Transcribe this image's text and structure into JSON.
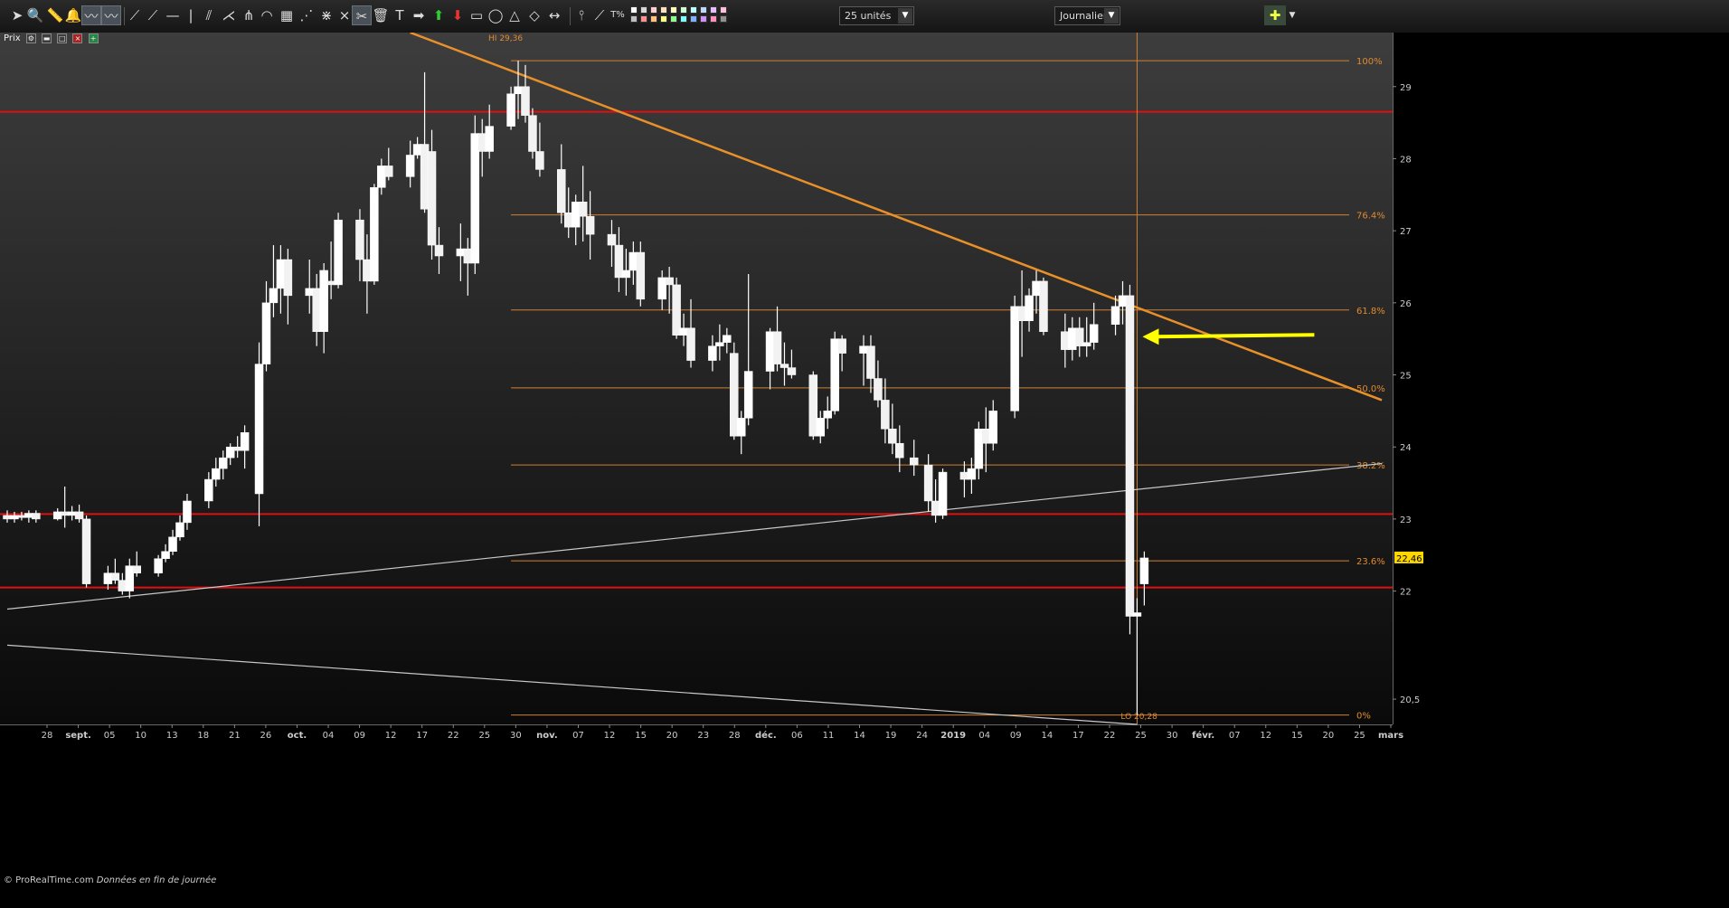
{
  "toolbar": {
    "units_value": "25 unités",
    "period_value": "Journalier",
    "swatch_colors": [
      "#ffffff",
      "#d8d8d8",
      "#ffd0d0",
      "#ffe0c0",
      "#ffffc0",
      "#d0ffd0",
      "#c0ffff",
      "#c0d8ff",
      "#e0c0ff",
      "#ffc0e0",
      "#c0c0c0",
      "#ff9090",
      "#ffc080",
      "#ffff80",
      "#90ff90",
      "#80ffff",
      "#80b0ff",
      "#d090ff",
      "#ff90c0",
      "#909090"
    ]
  },
  "panel": {
    "title": "Prix"
  },
  "copyright": {
    "brand": "© ProRealTime.com",
    "note": "Données en fin de journée"
  },
  "chart_data": {
    "type": "candlestick",
    "title": "",
    "xlabel": "",
    "ylabel": "",
    "ylim": [
      20.15,
      29.75
    ],
    "y_ticks": [
      "29",
      "28",
      "27",
      "26",
      "25",
      "24",
      "23",
      "22",
      "20,5"
    ],
    "current_price_label": "22,46",
    "x_ticks": [
      "28",
      "sept.",
      "05",
      "10",
      "13",
      "18",
      "21",
      "26",
      "oct.",
      "04",
      "09",
      "12",
      "17",
      "22",
      "25",
      "30",
      "nov.",
      "07",
      "12",
      "15",
      "20",
      "23",
      "28",
      "déc.",
      "06",
      "11",
      "14",
      "19",
      "24",
      "2019",
      "04",
      "09",
      "14",
      "17",
      "22",
      "25",
      "30",
      "févr.",
      "07",
      "12",
      "15",
      "20",
      "25",
      "mars"
    ],
    "x_ticks_bold": [
      "sept.",
      "oct.",
      "nov.",
      "déc.",
      "2019",
      "févr.",
      "mars"
    ],
    "x_range": [
      "2018-08-27",
      "2019-03-06"
    ],
    "candles": [
      [
        "2018-08-27",
        23.05,
        23.12,
        22.95,
        23.0
      ],
      [
        "2018-08-28",
        23.0,
        23.1,
        22.95,
        23.05
      ],
      [
        "2018-08-29",
        23.05,
        23.1,
        22.98,
        23.02
      ],
      [
        "2018-08-30",
        23.02,
        23.12,
        22.95,
        23.08
      ],
      [
        "2018-08-31",
        23.08,
        23.12,
        22.95,
        23.0
      ],
      [
        "2018-09-03",
        23.0,
        23.15,
        22.98,
        23.1
      ],
      [
        "2018-09-04",
        23.1,
        23.45,
        22.88,
        23.05
      ],
      [
        "2018-09-05",
        23.05,
        23.18,
        22.98,
        23.1
      ],
      [
        "2018-09-06",
        23.1,
        23.2,
        22.95,
        23.0
      ],
      [
        "2018-09-07",
        23.0,
        23.05,
        22.05,
        22.1
      ],
      [
        "2018-09-10",
        22.1,
        22.35,
        22.02,
        22.25
      ],
      [
        "2018-09-11",
        22.25,
        22.45,
        22.1,
        22.15
      ],
      [
        "2018-09-12",
        22.15,
        22.25,
        21.95,
        22.0
      ],
      [
        "2018-09-13",
        22.0,
        22.45,
        21.9,
        22.35
      ],
      [
        "2018-09-14",
        22.35,
        22.55,
        22.2,
        22.25
      ],
      [
        "2018-09-17",
        22.25,
        22.5,
        22.2,
        22.45
      ],
      [
        "2018-09-18",
        22.45,
        22.65,
        22.4,
        22.55
      ],
      [
        "2018-09-19",
        22.55,
        22.85,
        22.5,
        22.75
      ],
      [
        "2018-09-20",
        22.75,
        23.05,
        22.7,
        22.95
      ],
      [
        "2018-09-21",
        22.95,
        23.35,
        22.85,
        23.25
      ],
      [
        "2018-09-24",
        23.25,
        23.65,
        23.15,
        23.55
      ],
      [
        "2018-09-25",
        23.55,
        23.85,
        23.45,
        23.7
      ],
      [
        "2018-09-26",
        23.7,
        23.95,
        23.55,
        23.85
      ],
      [
        "2018-09-27",
        23.85,
        24.05,
        23.75,
        24.0
      ],
      [
        "2018-09-28",
        24.0,
        24.15,
        23.85,
        23.95
      ],
      [
        "2018-09-29",
        23.95,
        24.3,
        23.7,
        24.2
      ],
      [
        "2018-10-01",
        23.35,
        25.45,
        22.9,
        25.15
      ],
      [
        "2018-10-02",
        25.15,
        26.3,
        25.05,
        26.0
      ],
      [
        "2018-10-03",
        26.0,
        26.8,
        25.8,
        26.2
      ],
      [
        "2018-10-04",
        26.2,
        26.8,
        25.85,
        26.6
      ],
      [
        "2018-10-05",
        26.6,
        26.75,
        25.7,
        26.1
      ],
      [
        "2018-10-08",
        26.1,
        26.6,
        25.85,
        26.2
      ],
      [
        "2018-10-09",
        26.2,
        26.4,
        25.4,
        25.6
      ],
      [
        "2018-10-10",
        25.6,
        26.55,
        25.3,
        26.45
      ],
      [
        "2018-10-11",
        26.3,
        26.85,
        26.05,
        26.25
      ],
      [
        "2018-10-12",
        26.25,
        27.25,
        26.2,
        27.15
      ],
      [
        "2018-10-15",
        27.15,
        27.3,
        26.3,
        26.6
      ],
      [
        "2018-10-16",
        26.6,
        26.95,
        25.85,
        26.3
      ],
      [
        "2018-10-17",
        26.3,
        27.65,
        26.25,
        27.6
      ],
      [
        "2018-10-18",
        27.6,
        28.0,
        27.5,
        27.9
      ],
      [
        "2018-10-19",
        27.9,
        28.15,
        27.7,
        27.75
      ],
      [
        "2018-10-22",
        27.75,
        28.25,
        27.6,
        28.05
      ],
      [
        "2018-10-23",
        28.05,
        28.3,
        28.0,
        28.2
      ],
      [
        "2018-10-24",
        28.2,
        29.2,
        27.25,
        27.3
      ],
      [
        "2018-10-25",
        28.1,
        28.4,
        26.6,
        26.8
      ],
      [
        "2018-10-26",
        26.8,
        27.05,
        26.4,
        26.65
      ],
      [
        "2018-10-29",
        26.65,
        27.1,
        26.3,
        26.75
      ],
      [
        "2018-10-30",
        26.75,
        26.9,
        26.1,
        26.55
      ],
      [
        "2018-10-31",
        26.55,
        28.6,
        26.4,
        28.35
      ],
      [
        "2018-11-01",
        28.35,
        28.55,
        27.75,
        28.1
      ],
      [
        "2018-11-02",
        28.1,
        28.75,
        28.0,
        28.45
      ],
      [
        "2018-11-05",
        28.45,
        29.0,
        28.4,
        28.9
      ],
      [
        "2018-11-06",
        28.9,
        29.36,
        28.55,
        29.0
      ],
      [
        "2018-11-07",
        29.0,
        29.3,
        28.5,
        28.6
      ],
      [
        "2018-11-08",
        28.6,
        28.7,
        28.0,
        28.1
      ],
      [
        "2018-11-09",
        28.1,
        28.5,
        27.75,
        27.85
      ],
      [
        "2018-11-12",
        27.85,
        28.2,
        27.1,
        27.25
      ],
      [
        "2018-11-13",
        27.25,
        27.6,
        26.9,
        27.05
      ],
      [
        "2018-11-14",
        27.05,
        27.5,
        26.8,
        27.4
      ],
      [
        "2018-11-15",
        27.4,
        27.9,
        26.85,
        27.2
      ],
      [
        "2018-11-16",
        27.2,
        27.55,
        26.6,
        26.95
      ],
      [
        "2018-11-19",
        26.95,
        27.15,
        26.5,
        26.8
      ],
      [
        "2018-11-20",
        26.8,
        27.05,
        26.15,
        26.35
      ],
      [
        "2018-11-21",
        26.35,
        26.75,
        26.1,
        26.45
      ],
      [
        "2018-11-22",
        26.45,
        26.85,
        26.25,
        26.7
      ],
      [
        "2018-11-23",
        26.7,
        26.85,
        25.95,
        26.05
      ],
      [
        "2018-11-26",
        26.05,
        26.45,
        25.9,
        26.35
      ],
      [
        "2018-11-27",
        26.35,
        26.5,
        25.85,
        26.25
      ],
      [
        "2018-11-28",
        26.25,
        26.35,
        25.5,
        25.55
      ],
      [
        "2018-11-29",
        25.55,
        25.85,
        25.4,
        25.65
      ],
      [
        "2018-11-30",
        25.65,
        26.05,
        25.1,
        25.2
      ],
      [
        "2018-12-03",
        25.2,
        25.55,
        25.05,
        25.4
      ],
      [
        "2018-12-04",
        25.4,
        25.7,
        25.2,
        25.45
      ],
      [
        "2018-12-05",
        25.45,
        25.65,
        25.3,
        25.55
      ],
      [
        "2018-12-06",
        25.3,
        25.45,
        24.1,
        24.15
      ],
      [
        "2018-12-07",
        24.15,
        24.5,
        23.9,
        24.4
      ],
      [
        "2018-12-08",
        24.4,
        26.4,
        24.3,
        25.05
      ],
      [
        "2018-12-11",
        25.05,
        25.65,
        24.8,
        25.6
      ],
      [
        "2018-12-12",
        25.6,
        25.95,
        25.05,
        25.15
      ],
      [
        "2018-12-13",
        25.15,
        25.45,
        24.85,
        25.1
      ],
      [
        "2018-12-14",
        25.1,
        25.35,
        24.95,
        25.0
      ],
      [
        "2018-12-17",
        25.0,
        25.05,
        24.1,
        24.15
      ],
      [
        "2018-12-18",
        24.15,
        24.5,
        24.05,
        24.4
      ],
      [
        "2018-12-19",
        24.4,
        24.7,
        24.25,
        24.5
      ],
      [
        "2018-12-20",
        24.5,
        25.6,
        24.45,
        25.5
      ],
      [
        "2018-12-21",
        25.5,
        25.55,
        25.05,
        25.3
      ],
      [
        "2018-12-24",
        25.3,
        25.55,
        24.85,
        25.4
      ],
      [
        "2018-12-25",
        25.4,
        25.55,
        24.75,
        24.95
      ],
      [
        "2018-12-26",
        24.95,
        25.2,
        24.55,
        24.65
      ],
      [
        "2018-12-27",
        24.65,
        24.95,
        24.05,
        24.25
      ],
      [
        "2018-12-28",
        24.25,
        24.6,
        23.9,
        24.05
      ],
      [
        "2018-12-29",
        24.05,
        24.3,
        23.65,
        23.85
      ],
      [
        "2018-12-31",
        23.85,
        24.1,
        23.6,
        23.75
      ],
      [
        "2019-01-02",
        23.75,
        23.9,
        23.1,
        23.25
      ],
      [
        "2019-01-03",
        23.25,
        23.55,
        22.95,
        23.05
      ],
      [
        "2019-01-04",
        23.05,
        23.7,
        23.0,
        23.65
      ],
      [
        "2019-01-07",
        23.65,
        23.8,
        23.3,
        23.55
      ],
      [
        "2019-01-08",
        23.55,
        23.85,
        23.35,
        23.7
      ],
      [
        "2019-01-09",
        23.7,
        24.35,
        23.55,
        24.25
      ],
      [
        "2019-01-10",
        24.25,
        24.55,
        23.65,
        24.05
      ],
      [
        "2019-01-11",
        24.05,
        24.65,
        23.95,
        24.5
      ],
      [
        "2019-01-14",
        24.5,
        26.1,
        24.4,
        25.95
      ],
      [
        "2019-01-15",
        25.95,
        26.45,
        25.25,
        25.75
      ],
      [
        "2019-01-16",
        25.75,
        26.2,
        25.6,
        26.1
      ],
      [
        "2019-01-17",
        26.1,
        26.45,
        25.85,
        26.3
      ],
      [
        "2019-01-18",
        26.3,
        26.35,
        25.55,
        25.6
      ],
      [
        "2019-01-21",
        25.6,
        25.85,
        25.1,
        25.35
      ],
      [
        "2019-01-22",
        25.35,
        25.8,
        25.2,
        25.65
      ],
      [
        "2019-01-23",
        25.65,
        25.8,
        25.25,
        25.4
      ],
      [
        "2019-01-24",
        25.4,
        25.8,
        25.25,
        25.45
      ],
      [
        "2019-01-25",
        25.45,
        26.0,
        25.35,
        25.7
      ],
      [
        "2019-01-28",
        25.7,
        26.1,
        25.55,
        25.95
      ],
      [
        "2019-01-29",
        25.95,
        26.3,
        25.7,
        26.1
      ],
      [
        "2019-01-30",
        26.1,
        26.25,
        21.4,
        21.65
      ],
      [
        "2019-01-31",
        21.65,
        21.9,
        20.28,
        21.7
      ],
      [
        "2019-02-01",
        22.1,
        22.55,
        21.8,
        22.46
      ]
    ],
    "hi_label": "HI 29,36",
    "lo_label": "LO 20,28",
    "fibonacci": {
      "high": 29.36,
      "low": 20.28,
      "x_start": "2018-11-05",
      "levels": [
        {
          "value": 29.36,
          "label": "100%"
        },
        {
          "value": 27.22,
          "label": "76.4%"
        },
        {
          "value": 25.9,
          "label": "61.8%"
        },
        {
          "value": 24.82,
          "label": "50.0%"
        },
        {
          "value": 23.75,
          "label": "38.2%"
        },
        {
          "value": 22.42,
          "label": "23.6%"
        },
        {
          "value": 20.28,
          "label": "0%"
        }
      ]
    },
    "horizontal_lines": [
      28.65,
      23.07,
      22.05
    ],
    "trendlines": [
      {
        "color": "#e8902a",
        "points": [
          [
            "2018-10-22",
            29.75
          ],
          [
            "2019-03-06",
            24.65
          ]
        ]
      },
      {
        "color": "#c8c8c8",
        "points": [
          [
            "2018-08-27",
            21.75
          ],
          [
            "2019-03-06",
            23.77
          ]
        ]
      },
      {
        "color": "#c8c8c8",
        "points": [
          [
            "2018-08-27",
            21.25
          ],
          [
            "2019-01-31",
            20.15
          ]
        ]
      }
    ],
    "vertical_marker": "2019-01-31",
    "annotation_arrow": {
      "target": [
        "2019-01-31",
        25.53
      ],
      "color": "#ffff00"
    }
  }
}
